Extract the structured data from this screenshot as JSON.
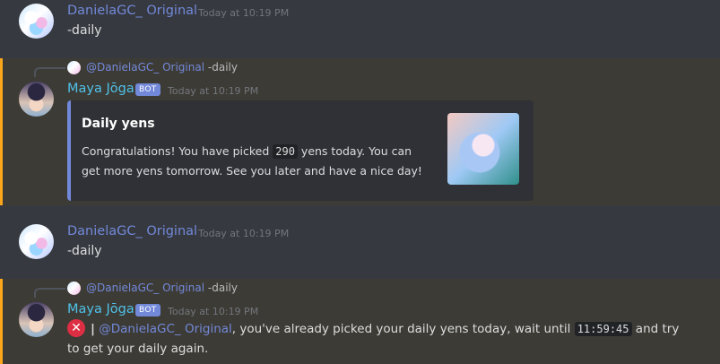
{
  "messages": [
    {
      "author": "DanielaGC_ Original",
      "timestamp": "Today at 10:19 PM",
      "content": "-daily"
    },
    {
      "reply": {
        "mention": "@DanielaGC_ Original",
        "text": "-daily"
      },
      "author": "Maya Jōga",
      "badge": "BOT",
      "timestamp": "Today at 10:19 PM",
      "embed": {
        "title": "Daily yens",
        "desc_before": "Congratulations! You have picked ",
        "code": "290",
        "desc_after": " yens today. You can get more yens tomorrow. See you later and have a nice day!",
        "thumbnail_icon": "anime-character-thumbnail"
      }
    },
    {
      "author": "DanielaGC_ Original",
      "timestamp": "Today at 10:19 PM",
      "content": "-daily"
    },
    {
      "reply": {
        "mention": "@DanielaGC_ Original",
        "text": "-daily"
      },
      "author": "Maya Jōga",
      "badge": "BOT",
      "timestamp": "Today at 10:19 PM",
      "status_icon": "x-circle-icon",
      "separator": "|",
      "mention": "@DanielaGC_ Original",
      "line1_text": ", you've already picked your daily yens today, wait until ",
      "code": "11:59:45",
      "line1_end": " and try",
      "line2_text": "to get your daily again."
    }
  ],
  "colors": {
    "background": "#36393f",
    "highlight": "#3d3b35",
    "highlight_bar": "#faa61a",
    "username": "#7289da",
    "bot_name": "#4fc1e9",
    "embed_bg": "#2f3136",
    "embed_border": "#7289da",
    "error": "#dd2e44"
  }
}
